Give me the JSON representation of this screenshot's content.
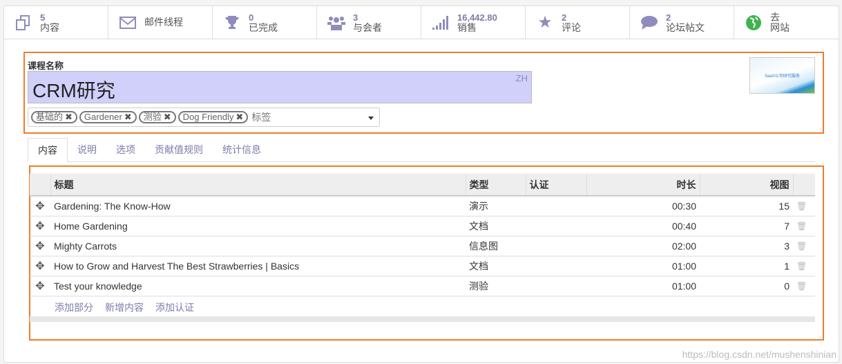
{
  "stats": [
    {
      "num": "5",
      "label": "内容",
      "icon": "copy-icon"
    },
    {
      "num": "",
      "label": "邮件线程",
      "icon": "envelope-icon"
    },
    {
      "num": "0",
      "label": "已完成",
      "icon": "trophy-icon"
    },
    {
      "num": "3",
      "label": "与会者",
      "icon": "users-icon"
    },
    {
      "num": "16,442.80",
      "label": "销售",
      "icon": "signal-icon"
    },
    {
      "num": "2",
      "label": "评论",
      "icon": "star-icon"
    },
    {
      "num": "2",
      "label": "论坛帖文",
      "icon": "comment-icon"
    },
    {
      "num": "去",
      "label": "网站",
      "icon": "globe-icon"
    }
  ],
  "form": {
    "name_label": "课程名称",
    "name": "CRM研究",
    "lang": "ZH",
    "tags": [
      "基础的",
      "Gardener",
      "测验",
      "Dog Friendly"
    ],
    "tags_placeholder": "标签",
    "thumbnail_text": "SaaS公司研究服务"
  },
  "tabs": [
    "内容",
    "说明",
    "选项",
    "贡献值规则",
    "统计信息"
  ],
  "table": {
    "headers": [
      "标题",
      "类型",
      "认证",
      "时长",
      "视图"
    ],
    "rows": [
      {
        "title": "Gardening: The Know-How",
        "type": "演示",
        "cert": "",
        "duration": "00:30",
        "views": "15"
      },
      {
        "title": "Home Gardening",
        "type": "文档",
        "cert": "",
        "duration": "00:40",
        "views": "7"
      },
      {
        "title": "Mighty Carrots",
        "type": "信息图",
        "cert": "",
        "duration": "02:00",
        "views": "3"
      },
      {
        "title": "How to Grow and Harvest The Best Strawberries | Basics",
        "type": "文档",
        "cert": "",
        "duration": "01:00",
        "views": "1"
      },
      {
        "title": "Test your knowledge",
        "type": "测验",
        "cert": "",
        "duration": "01:00",
        "views": "0"
      }
    ]
  },
  "actions": [
    "添加部分",
    "新增内容",
    "添加认证"
  ],
  "watermark": "https://blog.csdn.net/mushenshinian"
}
